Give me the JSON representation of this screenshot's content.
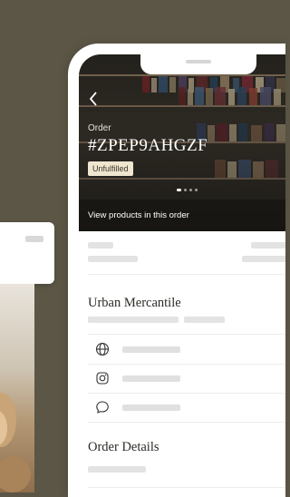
{
  "colors": {
    "background": "#5b5645",
    "badge_bg": "#efe6cf"
  },
  "order": {
    "label": "Order",
    "id": "#ZPEP9AHGZF",
    "status": "Unfulfilled",
    "view_products": "View products in this order",
    "back_icon": "chevron-left-icon"
  },
  "store": {
    "name": "Urban Mercantile",
    "contact_rows": [
      {
        "icon": "globe-icon"
      },
      {
        "icon": "instagram-icon"
      },
      {
        "icon": "chat-bubble-icon"
      }
    ]
  },
  "details": {
    "title": "Order Details"
  }
}
